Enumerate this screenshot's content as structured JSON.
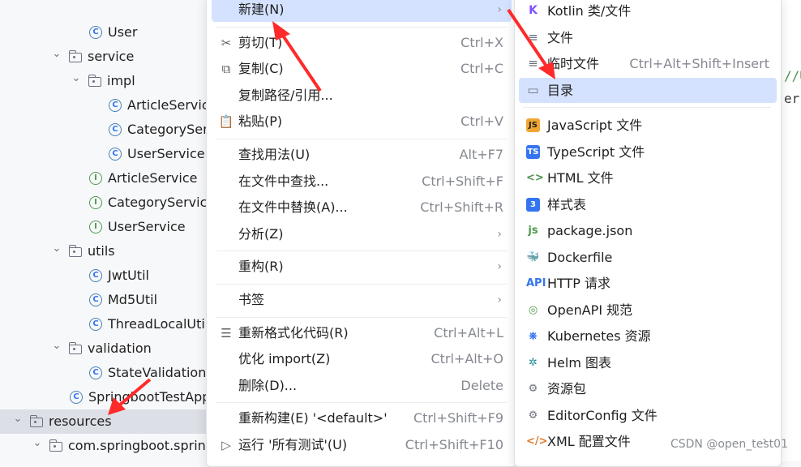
{
  "tree": [
    {
      "label": "User",
      "kind": "class",
      "level": 5,
      "chevron": ""
    },
    {
      "label": "service",
      "kind": "folder",
      "level": 3,
      "chevron": "v"
    },
    {
      "label": "impl",
      "kind": "folder",
      "level": 4,
      "chevron": "v"
    },
    {
      "label": "ArticleServiceImpl",
      "kind": "class",
      "level": 6,
      "chevron": ""
    },
    {
      "label": "CategoryServiceImpl",
      "kind": "class",
      "level": 6,
      "chevron": ""
    },
    {
      "label": "UserServiceImpl",
      "kind": "class",
      "level": 6,
      "chevron": ""
    },
    {
      "label": "ArticleService",
      "kind": "interface",
      "level": 5,
      "chevron": ""
    },
    {
      "label": "CategoryService",
      "kind": "interface",
      "level": 5,
      "chevron": ""
    },
    {
      "label": "UserService",
      "kind": "interface",
      "level": 5,
      "chevron": ""
    },
    {
      "label": "utils",
      "kind": "folder",
      "level": 3,
      "chevron": "v"
    },
    {
      "label": "JwtUtil",
      "kind": "class",
      "level": 5,
      "chevron": ""
    },
    {
      "label": "Md5Util",
      "kind": "class",
      "level": 5,
      "chevron": ""
    },
    {
      "label": "ThreadLocalUtil",
      "kind": "class",
      "level": 5,
      "chevron": ""
    },
    {
      "label": "validation",
      "kind": "folder",
      "level": 3,
      "chevron": "v"
    },
    {
      "label": "StateValidation",
      "kind": "class",
      "level": 5,
      "chevron": ""
    },
    {
      "label": "SpringbootTestApplication",
      "kind": "app",
      "level": 4,
      "chevron": ""
    },
    {
      "label": "resources",
      "kind": "resources",
      "level": 1,
      "chevron": "v",
      "selected": true
    },
    {
      "label": "com.springboot.springboot_test",
      "kind": "folder",
      "level": 2,
      "chevron": "v"
    }
  ],
  "editor": {
    "line1": "//U",
    "line2": "er"
  },
  "menu": {
    "items": [
      {
        "icon": "",
        "label": "新建(N)",
        "shortcut": "",
        "submenu": true,
        "highlight": true
      },
      {
        "sep": true
      },
      {
        "icon": "✂",
        "label": "剪切(T)",
        "shortcut": "Ctrl+X"
      },
      {
        "icon": "⧉",
        "label": "复制(C)",
        "shortcut": "Ctrl+C"
      },
      {
        "icon": "",
        "label": "复制路径/引用...",
        "shortcut": ""
      },
      {
        "icon": "📋",
        "label": "粘贴(P)",
        "shortcut": "Ctrl+V"
      },
      {
        "sep": true
      },
      {
        "icon": "",
        "label": "查找用法(U)",
        "shortcut": "Alt+F7"
      },
      {
        "icon": "",
        "label": "在文件中查找...",
        "shortcut": "Ctrl+Shift+F"
      },
      {
        "icon": "",
        "label": "在文件中替换(A)...",
        "shortcut": "Ctrl+Shift+R"
      },
      {
        "icon": "",
        "label": "分析(Z)",
        "shortcut": "",
        "submenu": true
      },
      {
        "sep": true
      },
      {
        "icon": "",
        "label": "重构(R)",
        "shortcut": "",
        "submenu": true
      },
      {
        "sep": true
      },
      {
        "icon": "",
        "label": "书签",
        "shortcut": "",
        "submenu": true
      },
      {
        "sep": true
      },
      {
        "icon": "☰",
        "label": "重新格式化代码(R)",
        "shortcut": "Ctrl+Alt+L"
      },
      {
        "icon": "",
        "label": "优化 import(Z)",
        "shortcut": "Ctrl+Alt+O"
      },
      {
        "icon": "",
        "label": "删除(D)...",
        "shortcut": "Delete"
      },
      {
        "sep": true
      },
      {
        "icon": "",
        "label": "重新构建(E) '<default>'",
        "shortcut": "Ctrl+Shift+F9"
      },
      {
        "icon": "▷",
        "label": "运行 '所有测试'(U)",
        "shortcut": "Ctrl+Shift+F10"
      }
    ]
  },
  "submenu": {
    "items": [
      {
        "icon": "K",
        "icon_name": "kotlin-icon",
        "label": "Kotlin 类/文件",
        "color": "#7f52ff"
      },
      {
        "icon": "≡",
        "icon_name": "file-icon",
        "label": "文件",
        "color": "#6c707e"
      },
      {
        "icon": "≡",
        "icon_name": "scratch-file-icon",
        "label": "临时文件",
        "shortcut": "Ctrl+Alt+Shift+Insert",
        "color": "#6c707e"
      },
      {
        "icon": "▭",
        "icon_name": "folder-icon",
        "label": "目录",
        "highlight": true,
        "color": "#6c707e"
      },
      {
        "sep": true
      },
      {
        "icon": "JS",
        "icon_name": "javascript-icon",
        "label": "JavaScript 文件",
        "color": "#f0a732",
        "dark": true
      },
      {
        "icon": "TS",
        "icon_name": "typescript-icon",
        "label": "TypeScript 文件",
        "color": "#3574f0"
      },
      {
        "icon": "<>",
        "icon_name": "html-icon",
        "label": "HTML 文件",
        "color": "#4e8f4e",
        "plain": true
      },
      {
        "icon": "3",
        "icon_name": "css-icon",
        "label": "样式表",
        "color": "#3574f0"
      },
      {
        "icon": "js",
        "icon_name": "package-json-icon",
        "label": "package.json",
        "color": "#4e9a4e",
        "plain": true
      },
      {
        "icon": "🐳",
        "icon_name": "docker-icon",
        "label": "Dockerfile",
        "color": "#2f6fd1",
        "plain": true
      },
      {
        "icon": "API",
        "icon_name": "api-icon",
        "label": "HTTP 请求",
        "color": "#3574f0",
        "plain": true
      },
      {
        "icon": "◎",
        "icon_name": "openapi-icon",
        "label": "OpenAPI 规范",
        "color": "#4e9a4e",
        "plain": true
      },
      {
        "icon": "⎈",
        "icon_name": "kubernetes-icon",
        "label": "Kubernetes 资源",
        "color": "#3574f0",
        "plain": true
      },
      {
        "icon": "✲",
        "icon_name": "helm-icon",
        "label": "Helm 图表",
        "color": "#208a9a",
        "plain": true
      },
      {
        "icon": "⚙",
        "icon_name": "package-icon",
        "label": "资源包",
        "color": "#6c707e",
        "plain": true
      },
      {
        "icon": "⚙",
        "icon_name": "gear-icon",
        "label": "EditorConfig 文件",
        "color": "#6c707e",
        "plain": true
      },
      {
        "icon": "</>",
        "icon_name": "xml-icon",
        "label": "XML 配置文件",
        "color": "#e07a2d",
        "plain": true,
        "submenu": true
      }
    ]
  },
  "watermark": "CSDN @open_test01"
}
